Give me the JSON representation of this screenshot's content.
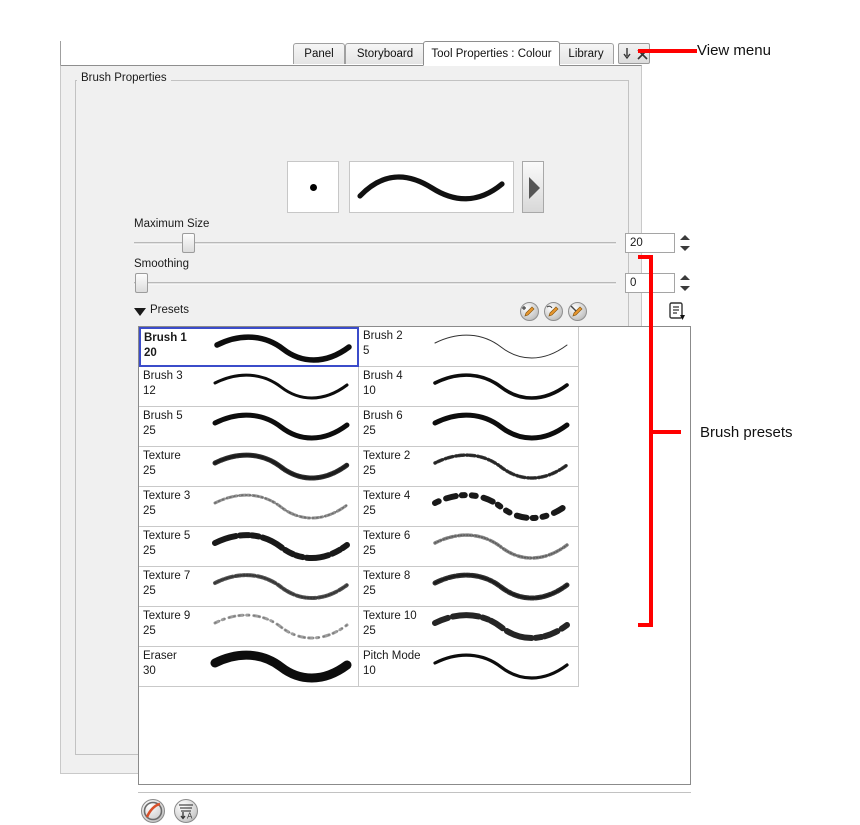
{
  "tabs": [
    {
      "label": "Panel",
      "active": false
    },
    {
      "label": "Storyboard",
      "active": false
    },
    {
      "label": "Tool Properties : Colour",
      "active": true
    },
    {
      "label": "Library",
      "active": false
    }
  ],
  "view_menu": {
    "name": "view-menu-button",
    "arrow": "down-arrow",
    "close": "x"
  },
  "group": {
    "title": "Brush Properties"
  },
  "preview": {
    "dot_name": "brush-tip-dot-preview",
    "stroke_name": "brush-stroke-preview",
    "expand_name": "expand-arrow-button"
  },
  "sliders": [
    {
      "label": "Maximum Size",
      "value": "20",
      "fill_pct": 10
    },
    {
      "label": "Smoothing",
      "value": "0",
      "fill_pct": 0
    }
  ],
  "presets": {
    "header_label": "Presets",
    "toolbar": [
      {
        "name": "new-brush-preset-icon"
      },
      {
        "name": "rename-brush-preset-icon"
      },
      {
        "name": "delete-brush-preset-icon"
      },
      {
        "name": "preset-menu-icon"
      }
    ],
    "items": [
      {
        "name": "Brush 1",
        "size": "20",
        "selected": true,
        "style": "taper-heavy",
        "opacity": 1
      },
      {
        "name": "Brush 2",
        "size": "5",
        "selected": false,
        "style": "thin",
        "opacity": 1
      },
      {
        "name": "Brush 3",
        "size": "12",
        "selected": false,
        "style": "taper-light",
        "opacity": 1
      },
      {
        "name": "Brush 4",
        "size": "10",
        "selected": false,
        "style": "medium",
        "opacity": 1
      },
      {
        "name": "Brush 5",
        "size": "25",
        "selected": false,
        "style": "thick",
        "opacity": 1
      },
      {
        "name": "Brush 6",
        "size": "25",
        "selected": false,
        "style": "thick",
        "opacity": 1
      },
      {
        "name": "Texture",
        "size": "25",
        "selected": false,
        "style": "texture-a",
        "opacity": 0.85
      },
      {
        "name": "Texture 2",
        "size": "25",
        "selected": false,
        "style": "texture-b",
        "opacity": 0.8
      },
      {
        "name": "Texture 3",
        "size": "25",
        "selected": false,
        "style": "texture-c",
        "opacity": 0.45
      },
      {
        "name": "Texture 4",
        "size": "25",
        "selected": false,
        "style": "texture-d",
        "opacity": 0.95
      },
      {
        "name": "Texture 5",
        "size": "25",
        "selected": false,
        "style": "texture-e",
        "opacity": 0.95
      },
      {
        "name": "Texture 6",
        "size": "25",
        "selected": false,
        "style": "texture-f",
        "opacity": 0.5
      },
      {
        "name": "Texture 7",
        "size": "25",
        "selected": false,
        "style": "texture-g",
        "opacity": 0.7
      },
      {
        "name": "Texture 8",
        "size": "25",
        "selected": false,
        "style": "texture-h",
        "opacity": 0.85
      },
      {
        "name": "Texture 9",
        "size": "25",
        "selected": false,
        "style": "texture-i",
        "opacity": 0.4
      },
      {
        "name": "Texture 10",
        "size": "25",
        "selected": false,
        "style": "texture-j",
        "opacity": 0.9
      },
      {
        "name": "Eraser",
        "size": "30",
        "selected": false,
        "style": "eraser",
        "opacity": 1
      },
      {
        "name": "Pitch Mode",
        "size": "10",
        "selected": false,
        "style": "pitch",
        "opacity": 1
      }
    ]
  },
  "bottom_toolbar": [
    {
      "name": "disable-pen-mode-icon"
    },
    {
      "name": "sort-alphabetically-icon"
    }
  ],
  "annotations": [
    {
      "label": "View menu"
    },
    {
      "label": "Brush presets"
    }
  ],
  "colors": {
    "annotation": "#ff0000",
    "selection": "#3b4cca"
  }
}
